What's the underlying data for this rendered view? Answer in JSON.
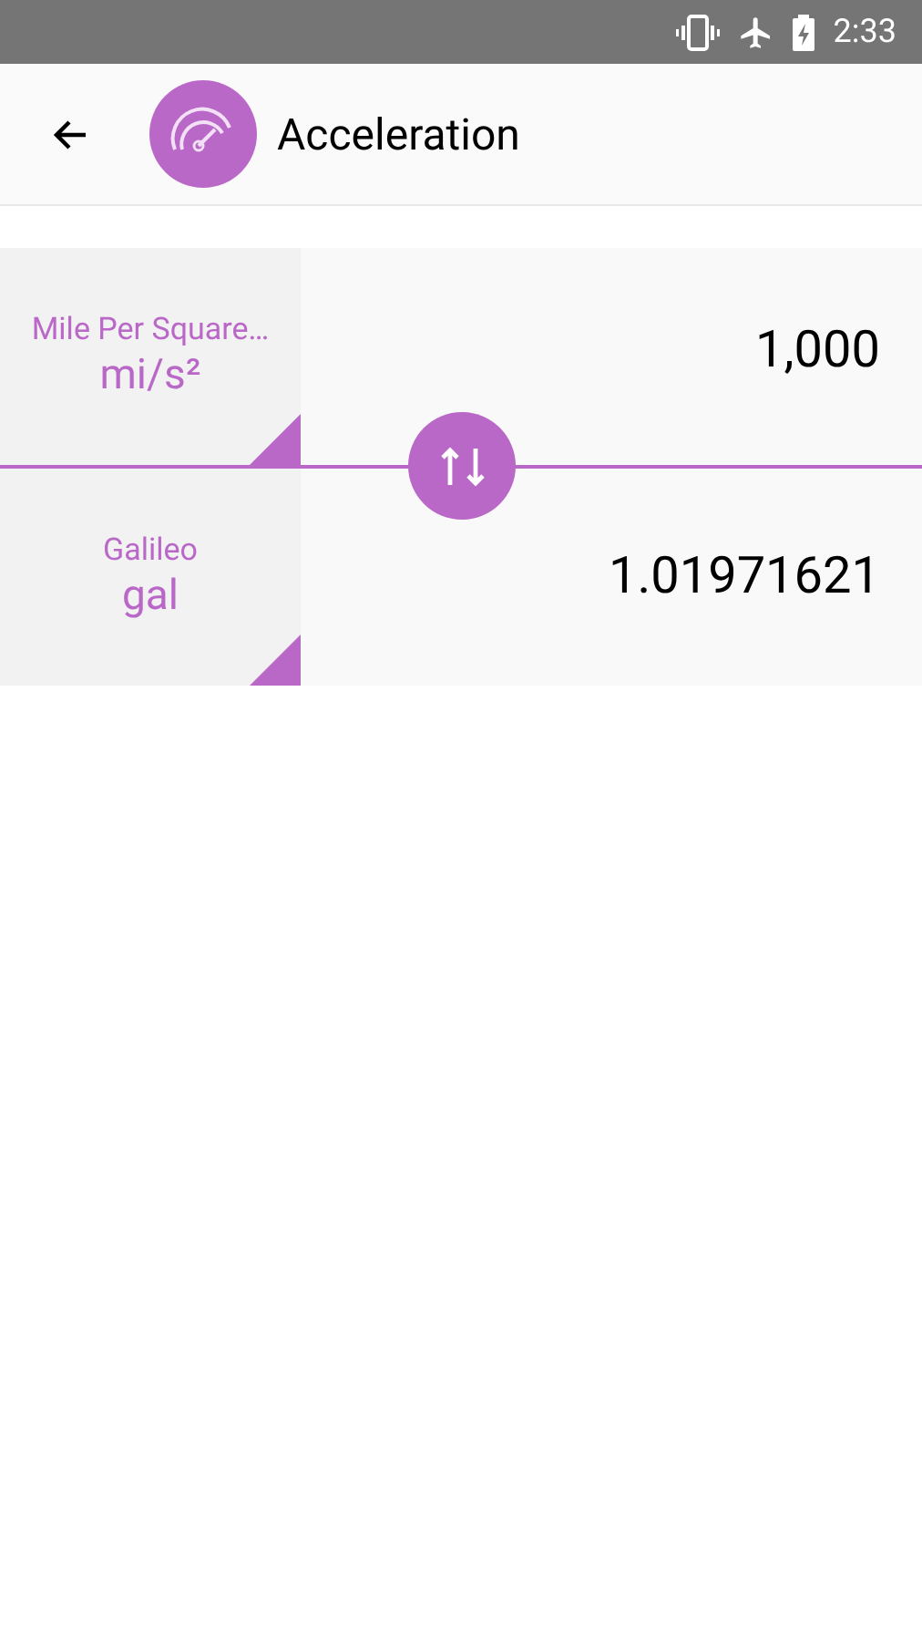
{
  "status_bar": {
    "time": "2:33"
  },
  "toolbar": {
    "title": "Acceleration"
  },
  "units": [
    {
      "name": "Mile Per Square…",
      "symbol": "mi/s²",
      "value": "1,000"
    },
    {
      "name": "Galileo",
      "symbol": "gal",
      "value": "1.01971621"
    }
  ]
}
